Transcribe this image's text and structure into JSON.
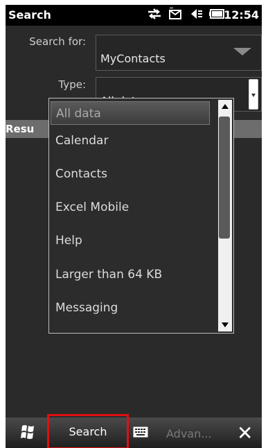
{
  "statusbar": {
    "title": "Search",
    "time": "12:54",
    "icons": [
      "sync-icon",
      "message-icon",
      "volume-icon",
      "battery-icon"
    ]
  },
  "form": {
    "search_for_label": "Search for:",
    "search_for_value": "MyContacts",
    "type_label": "Type:",
    "type_value": "All data"
  },
  "results_header": "Resu",
  "dropdown": {
    "items": [
      "All data",
      "Calendar",
      "Contacts",
      "Excel Mobile",
      "Help",
      "Larger than 64 KB",
      "Messaging"
    ],
    "selected_index": 0
  },
  "taskbar": {
    "search_label": "Search",
    "advanced_label": "Advan...",
    "close_label": "✕",
    "highlight_color": "#e01010"
  }
}
